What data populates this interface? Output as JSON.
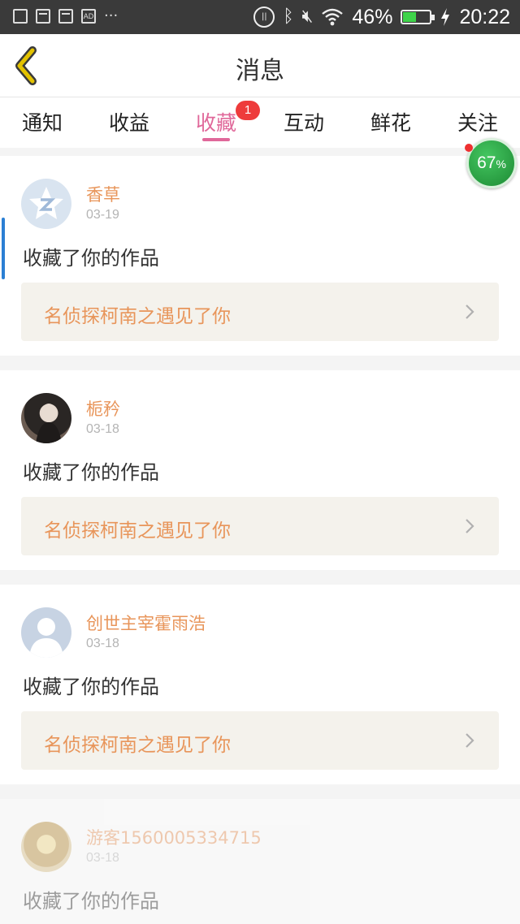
{
  "status_bar": {
    "left_icons": [
      "image-icon",
      "calendar-icon",
      "calendar-icon",
      "ad-icon",
      "more-dots-icon"
    ],
    "ad_label": "AD",
    "dots": "···",
    "battery_percent": "46%",
    "battery_level": 0.46,
    "time": "20:22",
    "accent": "#3fd34a"
  },
  "header": {
    "title": "消息",
    "back_icon": "back-chevron-icon",
    "back_color": "#e3c200"
  },
  "tabs": [
    {
      "label": "通知"
    },
    {
      "label": "收益"
    },
    {
      "label": "收藏",
      "active": true,
      "badge": "1"
    },
    {
      "label": "互动"
    },
    {
      "label": "鲜花"
    },
    {
      "label": "关注"
    }
  ],
  "float_ball": {
    "value": "67",
    "unit": "%"
  },
  "messages": [
    {
      "user": "香草",
      "date": "03-19",
      "text": "收藏了你的作品",
      "work": "名侦探柯南之遇见了你",
      "avatar": "qq-default-avatar"
    },
    {
      "user": "栀矜",
      "date": "03-18",
      "text": "收藏了你的作品",
      "work": "名侦探柯南之遇见了你",
      "avatar": "photo-avatar"
    },
    {
      "user": "创世主宰霍雨浩",
      "date": "03-18",
      "text": "收藏了你的作品",
      "work": "名侦探柯南之遇见了你",
      "avatar": "default-avatar"
    },
    {
      "user": "游客1560005334715",
      "date": "03-18",
      "text": "收藏了你的作品",
      "avatar": "photo-avatar"
    }
  ],
  "colors": {
    "active_tab": "#e0689a",
    "username": "#e8955a",
    "badge": "#ee3b3b",
    "scroll_indicator": "#2b7fd4"
  }
}
